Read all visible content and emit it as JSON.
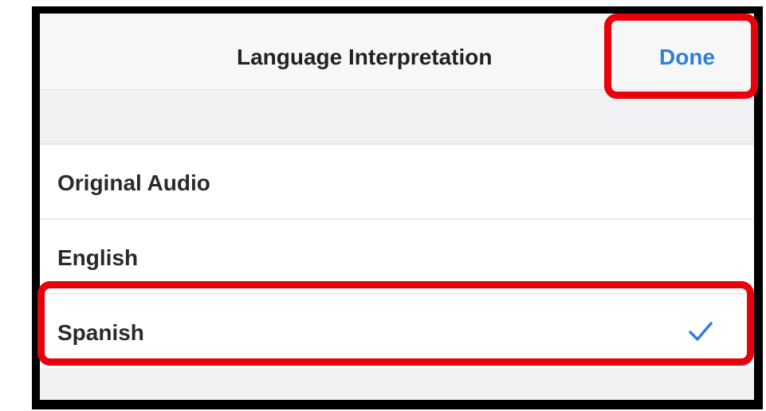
{
  "header": {
    "title": "Language Interpretation",
    "done_label": "Done"
  },
  "languages": {
    "items": [
      {
        "label": "Original Audio",
        "selected": false
      },
      {
        "label": "English",
        "selected": false
      },
      {
        "label": "Spanish",
        "selected": true
      }
    ]
  },
  "colors": {
    "accent": "#2f7fdc",
    "highlight": "#e8000b",
    "frame": "#000000",
    "text": "#2a2a2a"
  },
  "icons": {
    "selected_indicator": "checkmark-icon"
  }
}
